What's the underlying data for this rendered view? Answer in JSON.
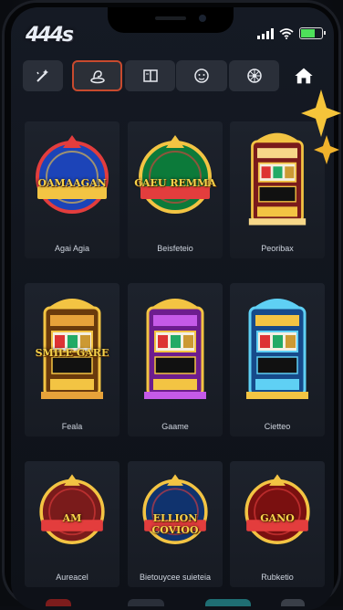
{
  "app": {
    "logo_text": "444s"
  },
  "status_bar": {
    "battery_fraction": 0.7,
    "battery_color": "#4ee05a",
    "signal_bars": 4,
    "icons": [
      "signal-icon",
      "wifi-icon",
      "battery-icon"
    ]
  },
  "nav": {
    "tabs": [
      {
        "icon": "sparkle-wand-icon",
        "active": false
      },
      {
        "icon": "coin-stack-icon",
        "active": true
      },
      {
        "icon": "book-icon",
        "active": false
      },
      {
        "icon": "face-icon",
        "active": false
      },
      {
        "icon": "wheel-icon",
        "active": false
      }
    ],
    "home_icon": "home-icon",
    "accent_color": "#c84a2e"
  },
  "games": [
    {
      "title": "Agai Agia",
      "art_text": "OAMAAGAN"
    },
    {
      "title": "Beisfeteio",
      "art_text": "CAEU REMMA"
    },
    {
      "title": "Peoribax",
      "art_text": ""
    },
    {
      "title": "Feala",
      "art_text": "SMILE GARE"
    },
    {
      "title": "Gaame",
      "art_text": ""
    },
    {
      "title": "Cietteo",
      "art_text": ""
    },
    {
      "title": "Aureacel",
      "art_text": "AM"
    },
    {
      "title": "Bietouycee suieteia",
      "art_text": "ELLION COVIOO"
    },
    {
      "title": "Rubketio",
      "art_text": "GANO"
    }
  ]
}
